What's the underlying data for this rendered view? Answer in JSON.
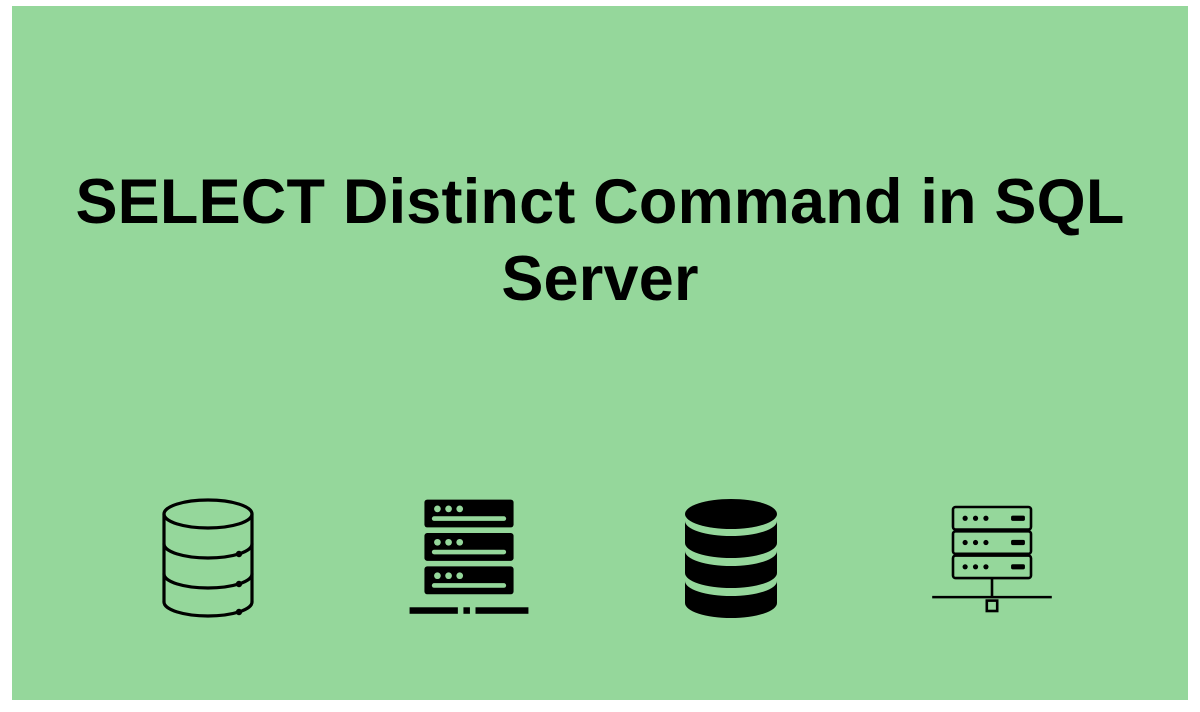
{
  "title": "SELECT Distinct Command in SQL Server",
  "colors": {
    "background": "#95d79b",
    "foreground": "#000000"
  },
  "icons": [
    "database-outline-icon",
    "server-rack-solid-icon",
    "database-solid-icon",
    "server-rack-network-outline-icon"
  ]
}
